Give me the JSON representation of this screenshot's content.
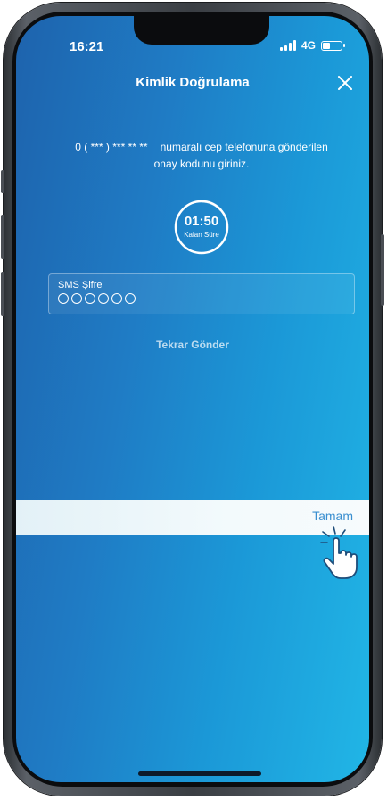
{
  "status_bar": {
    "time": "16:21",
    "network": "4G",
    "battery_level": 0.35
  },
  "header": {
    "title": "Kimlik Doğrulama",
    "close_icon": "close-icon"
  },
  "instruction": {
    "masked_phone": "0 ( *** ) *** ** **",
    "text_line1": "numaralı cep telefonuna gönderilen",
    "text_line2": "onay kodunu giriniz."
  },
  "timer": {
    "value": "01:50",
    "label": "Kalan Süre"
  },
  "sms_field": {
    "label": "SMS Şifre",
    "digit_count": 6
  },
  "resend": {
    "label": "Tekrar Gönder"
  },
  "keyboard_toolbar": {
    "done_label": "Tamam"
  },
  "colors": {
    "background_left": "#1e63ad",
    "background_right": "#21b6e6",
    "done_accent": "#3a8fd0"
  }
}
